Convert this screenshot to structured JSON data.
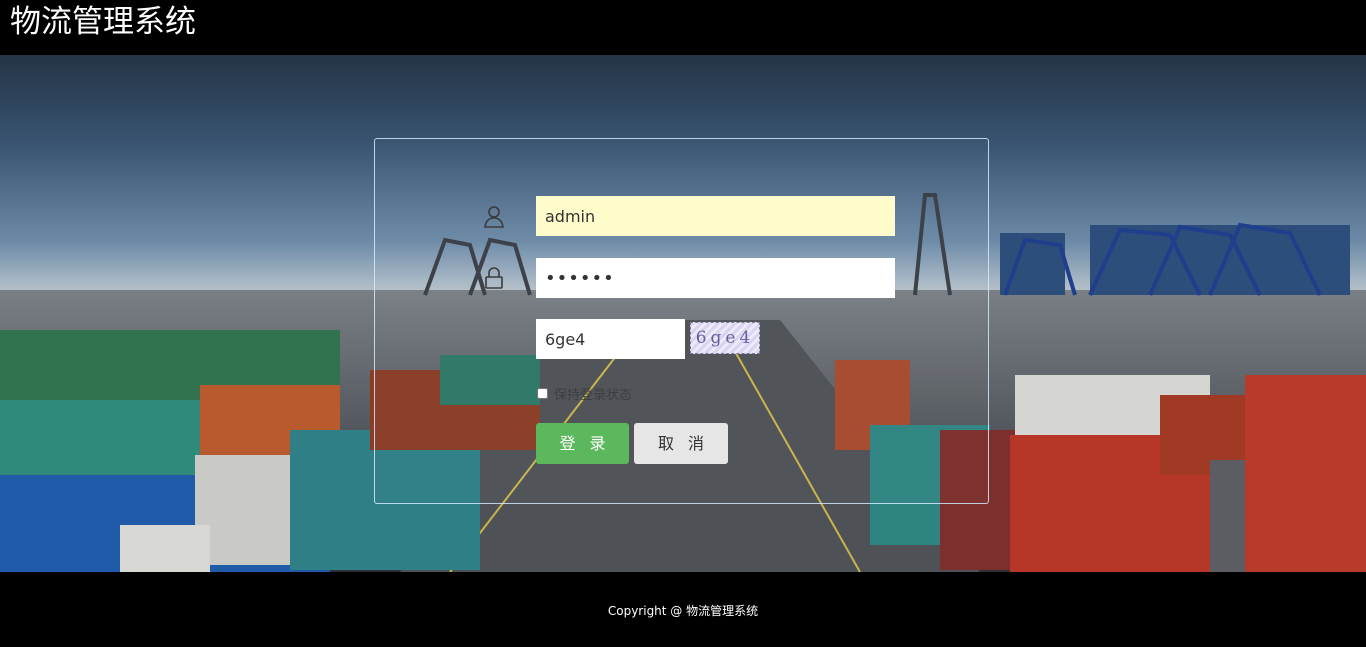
{
  "header": {
    "title": "物流管理系统"
  },
  "login": {
    "username_value": "admin",
    "password_value": "••••••",
    "captcha_value": "6ge4",
    "captcha_image_text": "6ge4",
    "remember_label": "保持登录状态",
    "login_label": "登录",
    "cancel_label": "取消"
  },
  "footer": {
    "copyright": "Copyright @ 物流管理系统"
  },
  "icons": {
    "user": "user-icon",
    "lock": "lock-icon"
  },
  "colors": {
    "login_button": "#5cb85c",
    "cancel_button": "#e6e6e6",
    "username_background": "#fffccc"
  }
}
